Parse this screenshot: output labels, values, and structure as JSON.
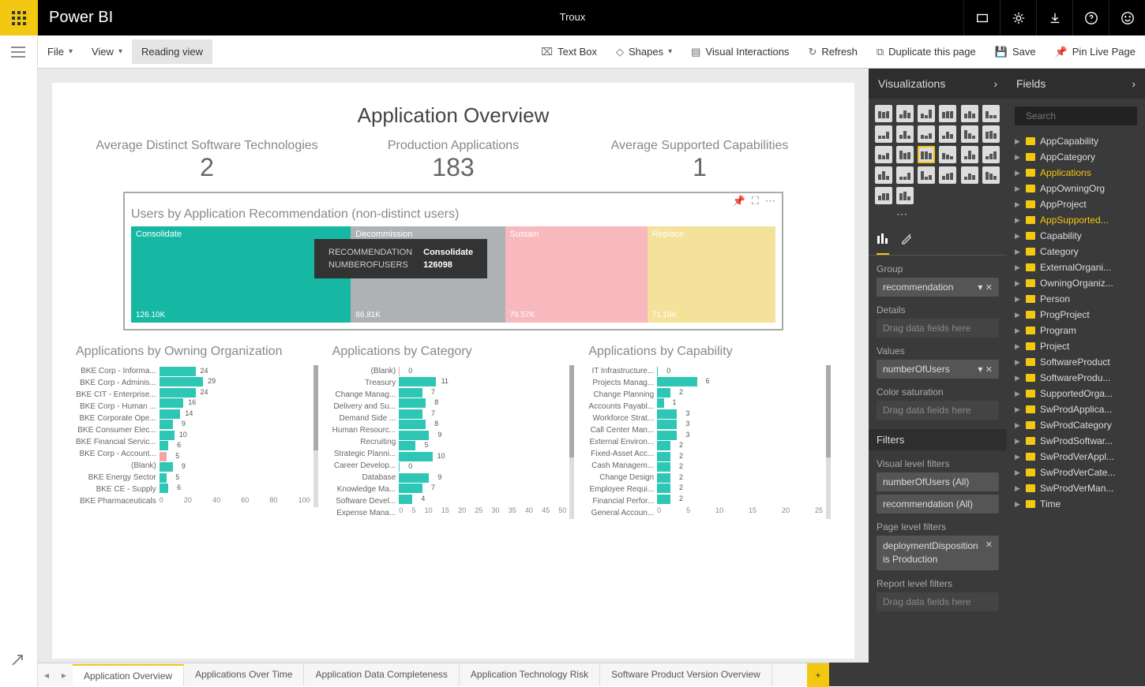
{
  "app": {
    "name": "Power BI",
    "doc_title": "Troux"
  },
  "topbar_icons": [
    "fullscreen",
    "gear",
    "download",
    "help",
    "smile"
  ],
  "cmdbar": {
    "file": "File",
    "view": "View",
    "reading": "Reading view",
    "textbox": "Text Box",
    "shapes": "Shapes",
    "visual_interactions": "Visual Interactions",
    "refresh": "Refresh",
    "duplicate": "Duplicate this page",
    "save": "Save",
    "pin": "Pin Live Page"
  },
  "panes": {
    "viz": "Visualizations",
    "fields": "Fields"
  },
  "fields_search_placeholder": "Search",
  "fields_list": [
    {
      "name": "AppCapability"
    },
    {
      "name": "AppCategory"
    },
    {
      "name": "Applications",
      "hl": true
    },
    {
      "name": "AppOwningOrg"
    },
    {
      "name": "AppProject"
    },
    {
      "name": "AppSupported...",
      "hl": true
    },
    {
      "name": "Capability"
    },
    {
      "name": "Category"
    },
    {
      "name": "ExternalOrgani..."
    },
    {
      "name": "OwningOrganiz..."
    },
    {
      "name": "Person"
    },
    {
      "name": "ProgProject"
    },
    {
      "name": "Program"
    },
    {
      "name": "Project"
    },
    {
      "name": "SoftwareProduct"
    },
    {
      "name": "SoftwareProdu..."
    },
    {
      "name": "SupportedOrga..."
    },
    {
      "name": "SwProdApplica..."
    },
    {
      "name": "SwProdCategory"
    },
    {
      "name": "SwProdSoftwar..."
    },
    {
      "name": "SwProdVerAppl..."
    },
    {
      "name": "SwProdVerCate..."
    },
    {
      "name": "SwProdVerMan..."
    },
    {
      "name": "Time"
    }
  ],
  "wells": {
    "group_label": "Group",
    "group_value": "recommendation",
    "details_label": "Details",
    "details_ph": "Drag data fields here",
    "values_label": "Values",
    "values_value": "numberOfUsers",
    "color_label": "Color saturation",
    "color_ph": "Drag data fields here"
  },
  "filters": {
    "header": "Filters",
    "visual_label": "Visual level filters",
    "visual_items": [
      "numberOfUsers (All)",
      "recommendation (All)"
    ],
    "page_label": "Page level filters",
    "page_item_line1": "deploymentDisposition",
    "page_item_line2": "is Production",
    "report_label": "Report level filters",
    "report_ph": "Drag data fields here"
  },
  "report": {
    "title": "Application Overview",
    "kpis": [
      {
        "label": "Average Distinct Software Technologies",
        "value": "2"
      },
      {
        "label": "Production Applications",
        "value": "183"
      },
      {
        "label": "Average Supported Capabilities",
        "value": "1"
      }
    ],
    "treemap": {
      "title": "Users by Application Recommendation (non-distinct users)",
      "tooltip_k1": "RECOMMENDATION",
      "tooltip_v1": "Consolidate",
      "tooltip_k2": "NUMBEROFUSERS",
      "tooltip_v2": "126098"
    }
  },
  "chart_data": {
    "treemap": {
      "type": "treemap",
      "cells": [
        {
          "name": "Consolidate",
          "value": 126098,
          "display": "126.10K",
          "color": "#16b8a4"
        },
        {
          "name": "Decommission",
          "value": 86810,
          "display": "86.81K",
          "color": "#aeb2b5"
        },
        {
          "name": "Sustain",
          "value": 79570,
          "display": "79.57K",
          "color": "#f7b9bd"
        },
        {
          "name": "Replace",
          "value": 71190,
          "display": "71.19K",
          "color": "#f4e19a"
        }
      ]
    },
    "by_org": {
      "type": "bar",
      "title": "Applications by Owning Organization",
      "xlim": [
        0,
        100
      ],
      "ticks": [
        0,
        20,
        40,
        60,
        80,
        100
      ],
      "categories": [
        "BKE Corp - Informa...",
        "BKE Corp - Adminis...",
        "BKE CIT - Enterprise...",
        "BKE Corp - Human ...",
        "BKE Corporate Ope...",
        "BKE Consumer Elec...",
        "BKE Financial Servic...",
        "BKE Corp - Account...",
        "(Blank)",
        "BKE Energy Sector",
        "BKE CE - Supply",
        "BKE Pharmaceuticals"
      ],
      "values": [
        24,
        29,
        24,
        16,
        14,
        9,
        10,
        6,
        5,
        9,
        5,
        6
      ]
    },
    "by_cat": {
      "type": "bar",
      "title": "Applications by Category",
      "xlim": [
        0,
        50
      ],
      "ticks": [
        0,
        5,
        10,
        15,
        20,
        25,
        30,
        35,
        40,
        45,
        50
      ],
      "categories": [
        "(Blank)",
        "Treasury",
        "Change Manag...",
        "Delivery and Su...",
        "Demand Side ...",
        "Human Resourc...",
        "Recruiting",
        "Strategic Planni...",
        "Career Develop...",
        "Database",
        "Knowledge Ma...",
        "Software Devel...",
        "Expense Mana..."
      ],
      "values": [
        0,
        11,
        7,
        8,
        7,
        8,
        9,
        5,
        10,
        0,
        9,
        7,
        4
      ]
    },
    "by_cap": {
      "type": "bar",
      "title": "Applications by Capability",
      "xlim": [
        0,
        25
      ],
      "ticks": [
        0,
        5,
        10,
        15,
        20,
        25
      ],
      "categories": [
        "IT Infrastructure...",
        "Projects Manag...",
        "Change Planning",
        "Accounts Payabl...",
        "Workforce Strat...",
        "Call Center Man...",
        "External Environ...",
        "Fixed-Asset Acc...",
        "Cash Managem...",
        "Change Design",
        "Employee Requi...",
        "Financial Perfor...",
        "General Accoun..."
      ],
      "values": [
        0,
        6,
        2,
        1,
        3,
        3,
        3,
        2,
        2,
        2,
        2,
        2,
        2
      ]
    }
  },
  "tabs": {
    "items": [
      "Application Overview",
      "Applications Over Time",
      "Application Data Completeness",
      "Application Technology Risk",
      "Software Product Version Overview"
    ],
    "active": 0
  }
}
